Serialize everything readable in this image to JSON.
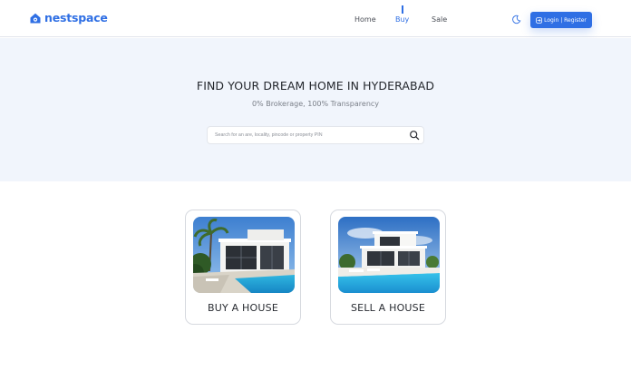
{
  "brand": {
    "name": "nestspace",
    "color": "#2f6fe4"
  },
  "nav": {
    "items": [
      {
        "label": "Home",
        "active": false
      },
      {
        "label": "Buy",
        "active": true
      },
      {
        "label": "Sale",
        "active": false
      }
    ]
  },
  "header": {
    "theme_icon": "moon-toggle-icon",
    "login_label": "Login | Register",
    "login_icon": "login-icon"
  },
  "hero": {
    "title": "FIND YOUR DREAM HOME IN HYDERABAD",
    "subtitle": "0% Brokerage, 100% Transparency",
    "search_placeholder": "Search for an are, locality, pincode or property PIN",
    "search_icon": "search-icon"
  },
  "cards": [
    {
      "label": "BUY A HOUSE",
      "image": "villa-with-pool-photo"
    },
    {
      "label": "SELL A HOUSE",
      "image": "villa-with-pool-photo"
    }
  ]
}
